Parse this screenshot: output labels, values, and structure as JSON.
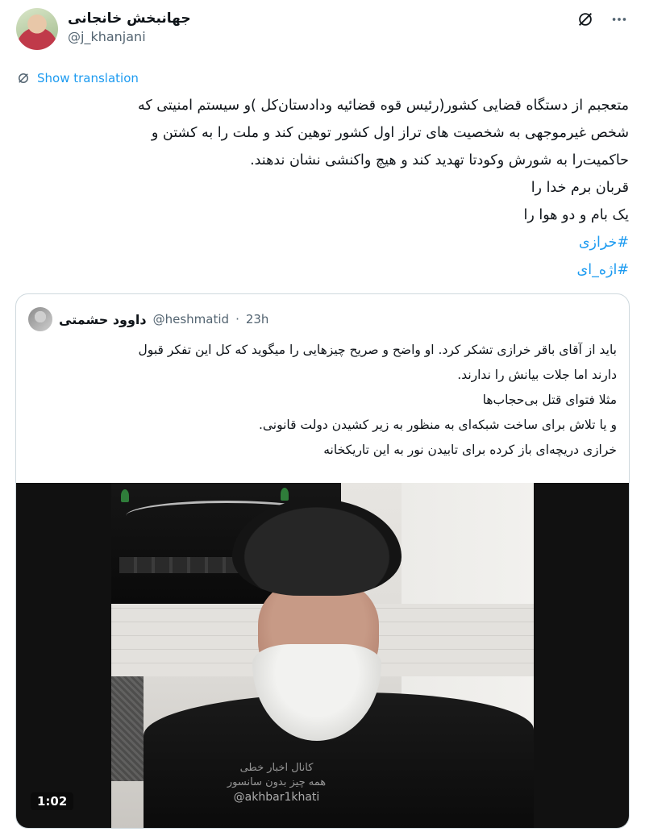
{
  "author": {
    "display_name": "جهانبخش خانجانی",
    "handle": "@j_khanjani"
  },
  "header_icons": [
    "grok-icon",
    "more-icon"
  ],
  "show_translation_label": "Show translation",
  "tweet_lines": [
    "متعجبم از دستگاه قضایی کشور(رئیس قوه قضائیه ودادستان‌کل )و سیستم امنیتی که",
    "شخص غیرموجهی به شخصیت های تراز اول کشور توهین کند و ملت را به کشتن و",
    "حاکمیت‌را به شورش وکودتا تهدید کند و هیچ واکنشی نشان ندهند.",
    "قربان برم خدا را",
    "یک بام و دو هوا را"
  ],
  "hashtags": [
    "#خرازی",
    "#اژه_ای"
  ],
  "quoted": {
    "display_name": "داوود حشمتی",
    "handle": "@heshmatid",
    "separator": "·",
    "time": "23h",
    "lines": [
      "باید از آقای باقر خرازی تشکر کرد. او واضح و صریح چیزهایی را میگوید که کل این تفکر قبول",
      "دارند اما جلات بیانش را ندارند.",
      "مثلا فتوای قتل بی‌حجاب‌ها",
      "و یا تلاش برای ساخت شبکه‌ای به منظور به زیر کشیدن دولت قانونی.",
      "خرازی دریچه‌ای باز کرده برای تابیدن نور به این تاریکخانه"
    ],
    "video": {
      "duration": "1:02",
      "watermark_line1": "کانال اخبار خطی",
      "watermark_line2": "همه چیز بدون سانسور",
      "watermark_handle": "@akhbar1khati"
    }
  },
  "colors": {
    "link": "#1d9bf0",
    "text": "#0f1419",
    "secondary": "#536471",
    "border": "#cfd9de"
  }
}
